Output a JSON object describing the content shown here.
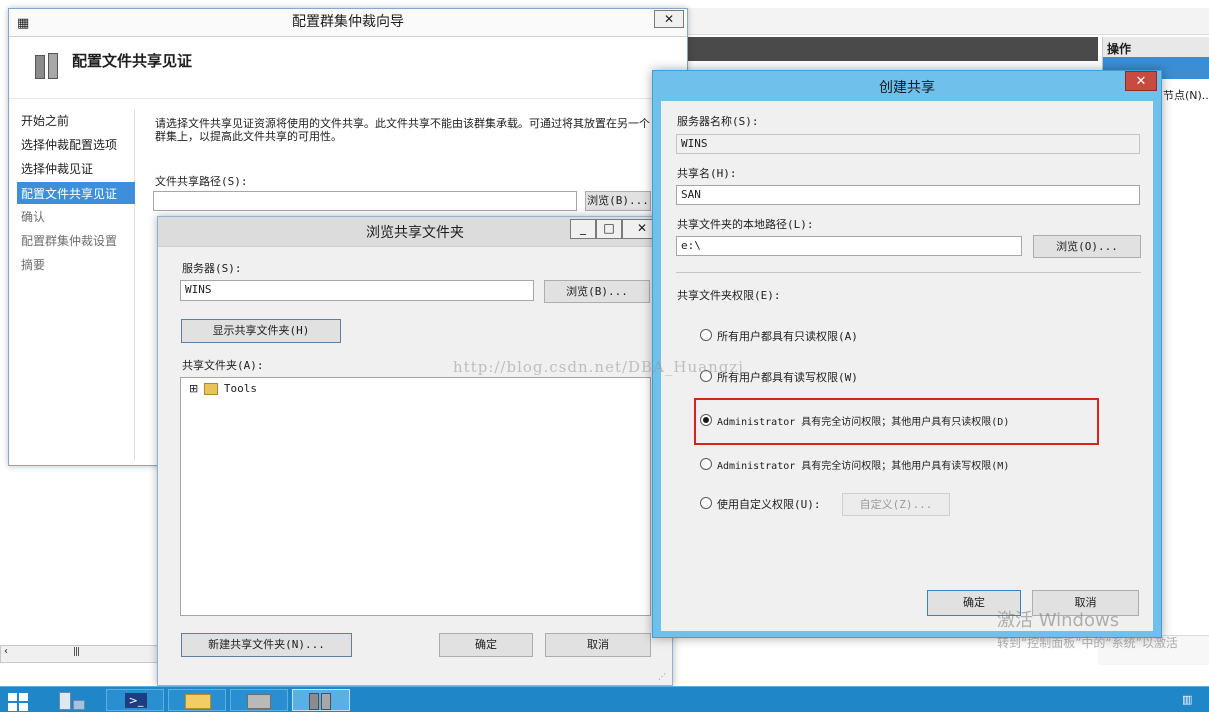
{
  "wizard": {
    "title": "配置群集仲裁向导",
    "header": "配置文件共享见证",
    "nav": [
      {
        "label": "开始之前"
      },
      {
        "label": "选择仲裁配置选项"
      },
      {
        "label": "选择仲裁见证"
      },
      {
        "label": "配置文件共享见证"
      },
      {
        "label": "确认"
      },
      {
        "label": "配置群集仲裁设置"
      },
      {
        "label": "摘要"
      }
    ],
    "description": "请选择文件共享见证资源将使用的文件共享。此文件共享不能由该群集承载。可通过将其放置在另一个群集上，以提高此文件共享的可用性。",
    "path_label": "文件共享路径(S):",
    "path_value": "",
    "browse_label": "浏览(B)..."
  },
  "browse_dialog": {
    "title": "浏览共享文件夹",
    "server_label": "服务器(S):",
    "server_value": "WINS",
    "browse_label": "浏览(B)...",
    "show_shares_label": "显示共享文件夹(H)",
    "shares_label": "共享文件夹(A):",
    "tree": [
      {
        "expander": "⊞",
        "label": "Tools"
      }
    ],
    "new_share_label": "新建共享文件夹(N)...",
    "ok_label": "确定",
    "cancel_label": "取消"
  },
  "create_dialog": {
    "title": "创建共享",
    "server_name_label": "服务器名称(S):",
    "server_name_value": "WINS",
    "share_name_label": "共享名(H):",
    "share_name_value": "SAN",
    "local_path_label": "共享文件夹的本地路径(L):",
    "local_path_value": "e:\\",
    "browse_label": "浏览(O)...",
    "permissions_label": "共享文件夹权限(E):",
    "options": [
      {
        "label": "所有用户都具有只读权限(A)",
        "selected": false
      },
      {
        "label": "所有用户都具有读写权限(W)",
        "selected": false
      },
      {
        "label": "Administrator 具有完全访问权限；其他用户具有只读权限(D)",
        "selected": true
      },
      {
        "label": "Administrator 具有完全访问权限；其他用户具有读写权限(M)",
        "selected": false
      },
      {
        "label": "使用自定义权限(U):",
        "selected": false
      }
    ],
    "custom_label": "自定义(Z)...",
    "ok_label": "确定",
    "cancel_label": "取消",
    "highlight_color": "#d9231b"
  },
  "background": {
    "actions_title": "操作",
    "actions_item": "节点(N)..."
  },
  "watermark": {
    "url": "http://blog.csdn.net/DBA_Huangzj",
    "activate_title": "激活 Windows",
    "activate_sub": "转到“控制面板”中的“系统”以激活"
  },
  "taskbar": {
    "items": [
      {
        "icon": "windows-start-icon"
      },
      {
        "icon": "server-manager-icon"
      },
      {
        "icon": "powershell-icon"
      },
      {
        "icon": "file-explorer-icon"
      },
      {
        "icon": "failover-cluster-icon"
      },
      {
        "icon": "cluster-manager-icon"
      }
    ]
  }
}
